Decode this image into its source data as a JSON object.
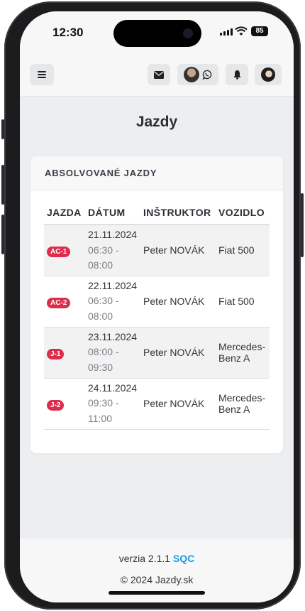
{
  "status": {
    "time": "12:30",
    "battery": "85"
  },
  "page": {
    "title": "Jazdy"
  },
  "card": {
    "title": "ABSOLVOVANÉ JAZDY"
  },
  "table": {
    "headers": [
      "JAZDA",
      "DÁTUM",
      "INŠTRUKTOR",
      "VOZIDLO"
    ],
    "rows": [
      {
        "badge": "AC-1",
        "date": "21.11.2024",
        "time_from": "06:30 -",
        "time_to": "08:00",
        "instructor": "Peter NOVÁK",
        "vehicle_line1": "Fiat 500",
        "vehicle_line2": ""
      },
      {
        "badge": "AC-2",
        "date": "22.11.2024",
        "time_from": "06:30 -",
        "time_to": "08:00",
        "instructor": "Peter NOVÁK",
        "vehicle_line1": "Fiat 500",
        "vehicle_line2": ""
      },
      {
        "badge": "J-1",
        "date": "23.11.2024",
        "time_from": "08:00 -",
        "time_to": "09:30",
        "instructor": "Peter NOVÁK",
        "vehicle_line1": "Mercedes-",
        "vehicle_line2": "Benz A"
      },
      {
        "badge": "J-2",
        "date": "24.11.2024",
        "time_from": "09:30 -",
        "time_to": "11:00",
        "instructor": "Peter NOVÁK",
        "vehicle_line1": "Mercedes-",
        "vehicle_line2": "Benz A"
      }
    ]
  },
  "footer": {
    "version": "verzia 2.1.1",
    "link": "SQC",
    "copyright": "© 2024 Jazdy.sk"
  },
  "icons": {
    "menu": "hamburger-icon",
    "mail": "envelope-icon",
    "whatsapp": "whatsapp-icon",
    "bell": "bell-icon"
  },
  "colors": {
    "badge": "#dc2d4a",
    "link": "#1a9be0"
  }
}
